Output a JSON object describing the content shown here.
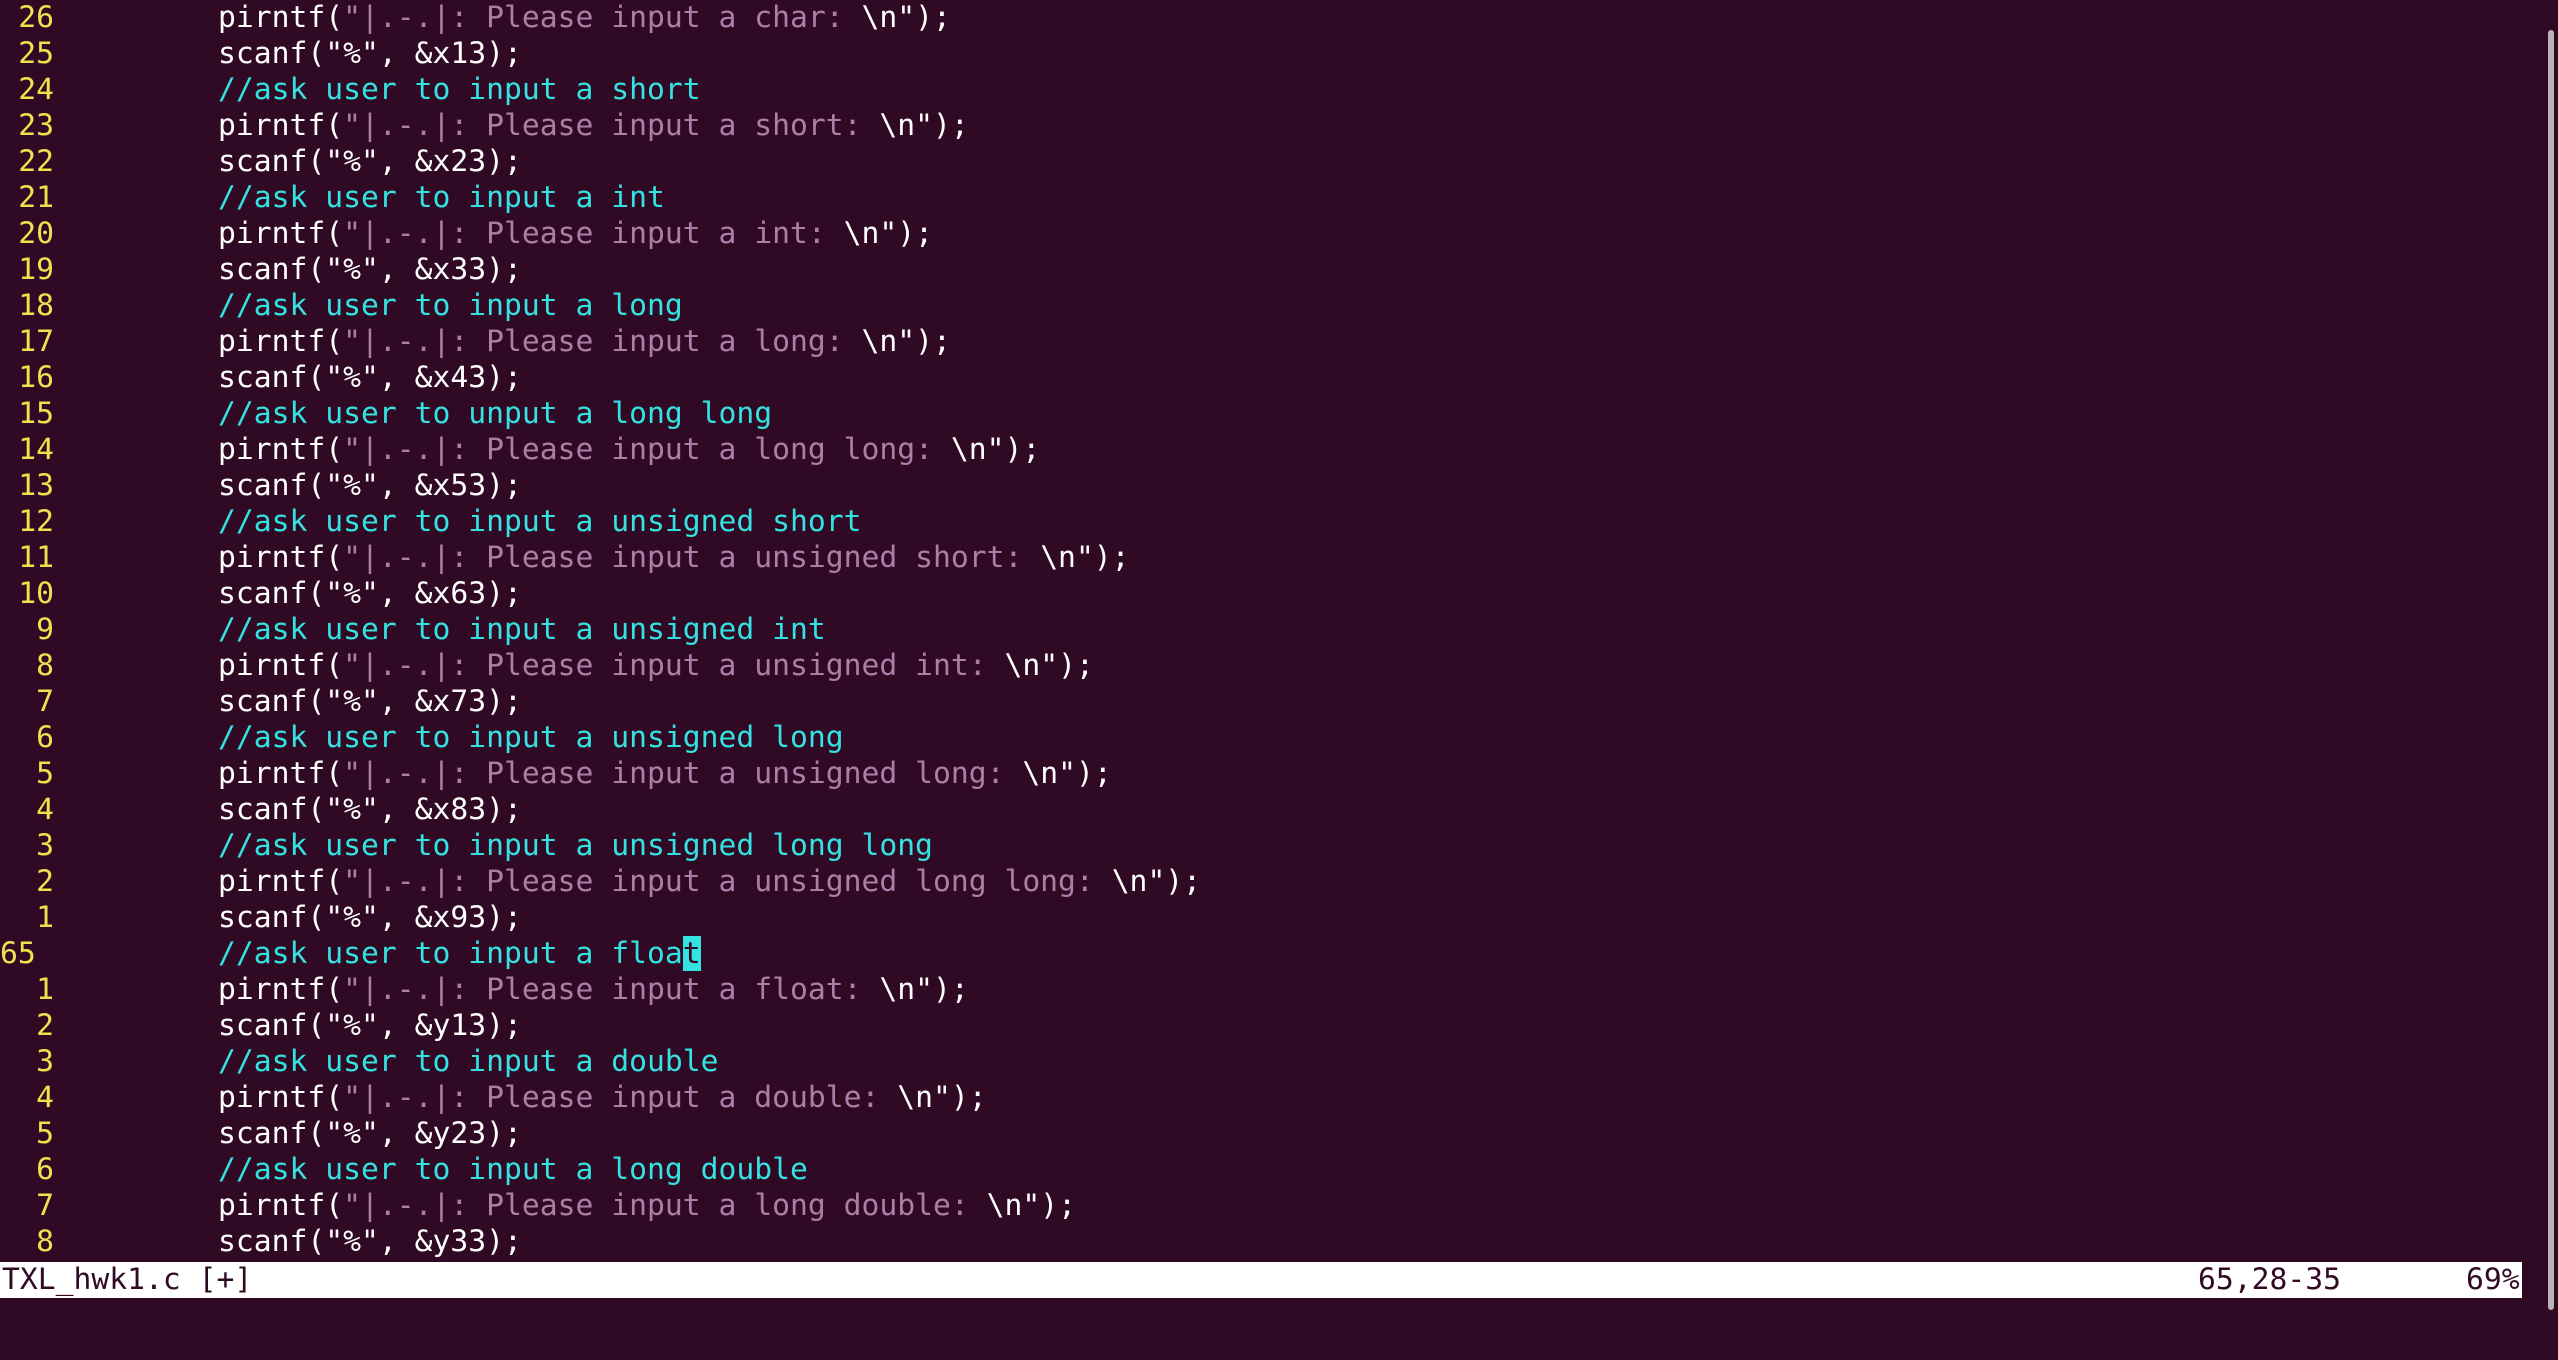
{
  "file": {
    "name": "TXL_hwk1.c [+]",
    "cursor_position": "65,28-35",
    "scroll_percent": "69%"
  },
  "lines": [
    {
      "num": "26",
      "type": "code",
      "pre": "pirntf(",
      "str": "\"|.-.|: Please input a char: ",
      "esc": "\\n",
      "post": "\");"
    },
    {
      "num": "25",
      "type": "plain",
      "text": "scanf(\"%\", &x13);"
    },
    {
      "num": "24",
      "type": "comment",
      "text": "//ask user to input a short"
    },
    {
      "num": "23",
      "type": "code",
      "pre": "pirntf(",
      "str": "\"|.-.|: Please input a short: ",
      "esc": "\\n",
      "post": "\");"
    },
    {
      "num": "22",
      "type": "plain",
      "text": "scanf(\"%\", &x23);"
    },
    {
      "num": "21",
      "type": "comment",
      "text": "//ask user to input a int"
    },
    {
      "num": "20",
      "type": "code",
      "pre": "pirntf(",
      "str": "\"|.-.|: Please input a int: ",
      "esc": "\\n",
      "post": "\");"
    },
    {
      "num": "19",
      "type": "plain",
      "text": "scanf(\"%\", &x33);"
    },
    {
      "num": "18",
      "type": "comment",
      "text": "//ask user to input a long"
    },
    {
      "num": "17",
      "type": "code",
      "pre": "pirntf(",
      "str": "\"|.-.|: Please input a long: ",
      "esc": "\\n",
      "post": "\");"
    },
    {
      "num": "16",
      "type": "plain",
      "text": "scanf(\"%\", &x43);"
    },
    {
      "num": "15",
      "type": "comment",
      "text": "//ask user to unput a long long"
    },
    {
      "num": "14",
      "type": "code",
      "pre": "pirntf(",
      "str": "\"|.-.|: Please input a long long: ",
      "esc": "\\n",
      "post": "\");"
    },
    {
      "num": "13",
      "type": "plain",
      "text": "scanf(\"%\", &x53);"
    },
    {
      "num": "12",
      "type": "comment",
      "text": "//ask user to input a unsigned short"
    },
    {
      "num": "11",
      "type": "code",
      "pre": "pirntf(",
      "str": "\"|.-.|: Please input a unsigned short: ",
      "esc": "\\n",
      "post": "\");"
    },
    {
      "num": "10",
      "type": "plain",
      "text": "scanf(\"%\", &x63);"
    },
    {
      "num": "9",
      "type": "comment",
      "text": "//ask user to input a unsigned int"
    },
    {
      "num": "8",
      "type": "code",
      "pre": "pirntf(",
      "str": "\"|.-.|: Please input a unsigned int: ",
      "esc": "\\n",
      "post": "\");"
    },
    {
      "num": "7",
      "type": "plain",
      "text": "scanf(\"%\", &x73);"
    },
    {
      "num": "6",
      "type": "comment",
      "text": "//ask user to input a unsigned long"
    },
    {
      "num": "5",
      "type": "code",
      "pre": "pirntf(",
      "str": "\"|.-.|: Please input a unsigned long: ",
      "esc": "\\n",
      "post": "\");"
    },
    {
      "num": "4",
      "type": "plain",
      "text": "scanf(\"%\", &x83);"
    },
    {
      "num": "3",
      "type": "comment",
      "text": "//ask user to input a unsigned long long"
    },
    {
      "num": "2",
      "type": "code",
      "pre": "pirntf(",
      "str": "\"|.-.|: Please input a unsigned long long: ",
      "esc": "\\n",
      "post": "\");"
    },
    {
      "num": "1",
      "type": "plain",
      "text": "scanf(\"%\", &x93);"
    },
    {
      "num": "65",
      "type": "cursorline",
      "before": "//ask user to input a floa",
      "cursor": "t",
      "after": "",
      "current": true
    },
    {
      "num": "1",
      "type": "code",
      "pre": "pirntf(",
      "str": "\"|.-.|: Please input a float: ",
      "esc": "\\n",
      "post": "\");"
    },
    {
      "num": "2",
      "type": "plain",
      "text": "scanf(\"%\", &y13);"
    },
    {
      "num": "3",
      "type": "comment",
      "text": "//ask user to input a double"
    },
    {
      "num": "4",
      "type": "code",
      "pre": "pirntf(",
      "str": "\"|.-.|: Please input a double: ",
      "esc": "\\n",
      "post": "\");"
    },
    {
      "num": "5",
      "type": "plain",
      "text": "scanf(\"%\", &y23);"
    },
    {
      "num": "6",
      "type": "comment",
      "text": "//ask user to input a long double"
    },
    {
      "num": "7",
      "type": "code",
      "pre": "pirntf(",
      "str": "\"|.-.|: Please input a long double: ",
      "esc": "\\n",
      "post": "\");"
    },
    {
      "num": "8",
      "type": "plain",
      "text": "scanf(\"%\", &y33);"
    }
  ]
}
